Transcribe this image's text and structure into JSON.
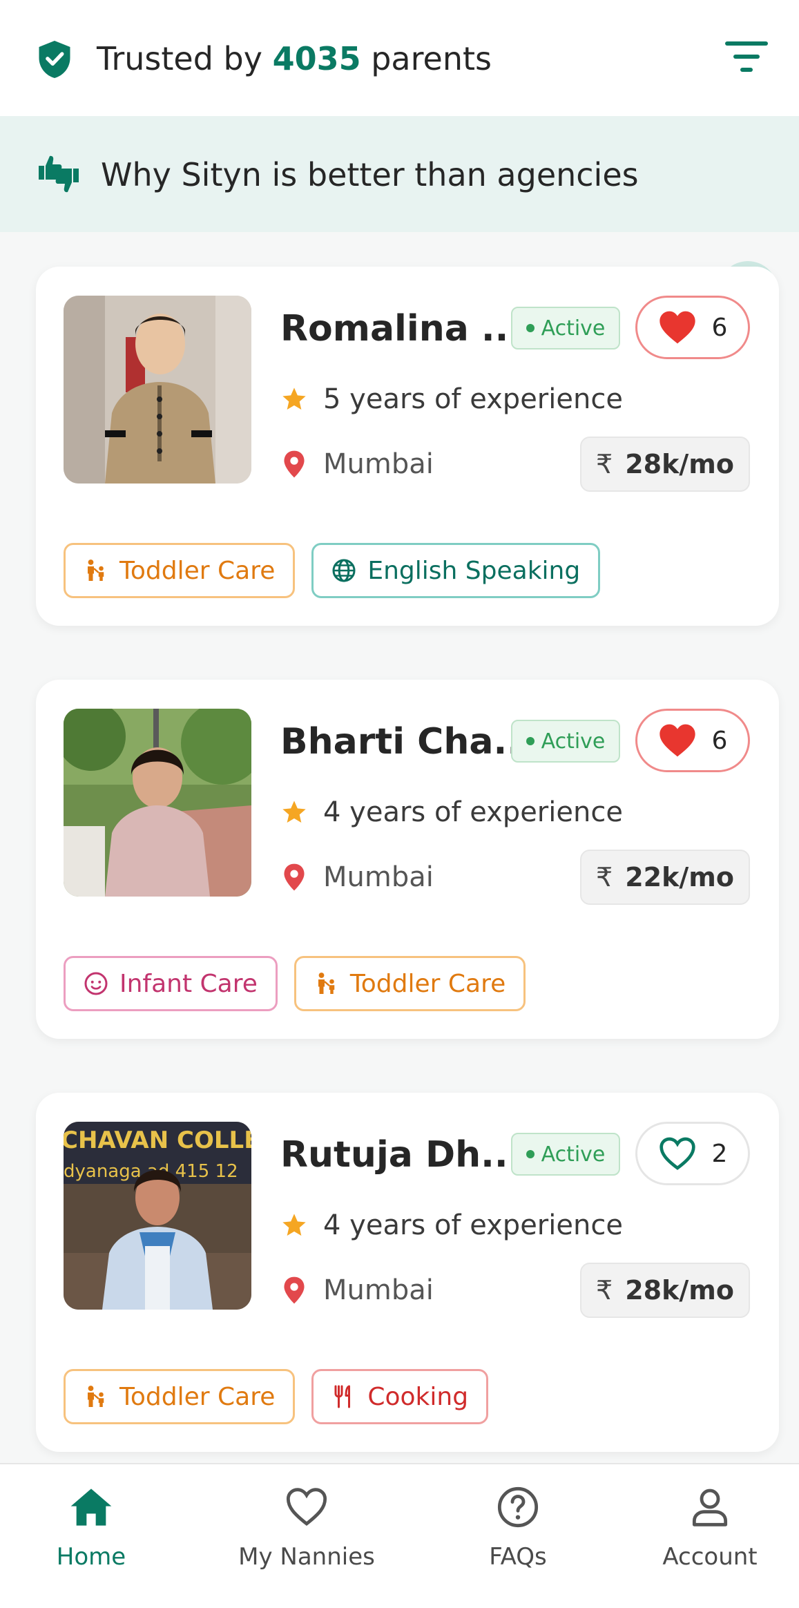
{
  "header": {
    "trust_prefix": "Trusted by",
    "trust_count": "4035",
    "trust_suffix": "parents",
    "shield_icon": "shield-check-icon",
    "filter_icon": "filter-icon"
  },
  "banner": {
    "text": "Why Sityn is better than agencies",
    "icon": "thumbs-icon",
    "arrow_icon": "arrow-right-icon"
  },
  "nannies": [
    {
      "name": "Romalina ...",
      "status": "Active",
      "likes": "6",
      "liked": true,
      "experience": "5 years of experience",
      "location": "Mumbai",
      "rupee": "₹",
      "price": "28k/mo",
      "tags": [
        {
          "label": "Toddler Care",
          "kind": "toddler",
          "icon": "toddler-icon"
        },
        {
          "label": "English Speaking",
          "kind": "english",
          "icon": "globe-icon"
        }
      ]
    },
    {
      "name": "Bharti Cha...",
      "status": "Active",
      "likes": "6",
      "liked": true,
      "experience": "4 years of experience",
      "location": "Mumbai",
      "rupee": "₹",
      "price": "22k/mo",
      "tags": [
        {
          "label": "Infant Care",
          "kind": "infant",
          "icon": "baby-face-icon"
        },
        {
          "label": "Toddler Care",
          "kind": "toddler",
          "icon": "toddler-icon"
        }
      ]
    },
    {
      "name": "Rutuja Dh...",
      "status": "Active",
      "likes": "2",
      "liked": false,
      "experience": "4 years of experience",
      "location": "Mumbai",
      "rupee": "₹",
      "price": "28k/mo",
      "photo_text_line1": "CHAVAN COLLE",
      "photo_text_line2": "dyanaga     ad 415 12",
      "tags": [
        {
          "label": "Toddler Care",
          "kind": "toddler",
          "icon": "toddler-icon"
        },
        {
          "label": "Cooking",
          "kind": "cooking",
          "icon": "utensils-icon"
        }
      ]
    }
  ],
  "nav": {
    "home": "Home",
    "my_nannies": "My Nannies",
    "faqs": "FAQs",
    "account": "Account",
    "active": "home"
  },
  "colors": {
    "brand": "#0a7a63",
    "banner_bg": "#e8f3f1",
    "active_green": "#2f9e57",
    "heart_red": "#e8362f"
  }
}
